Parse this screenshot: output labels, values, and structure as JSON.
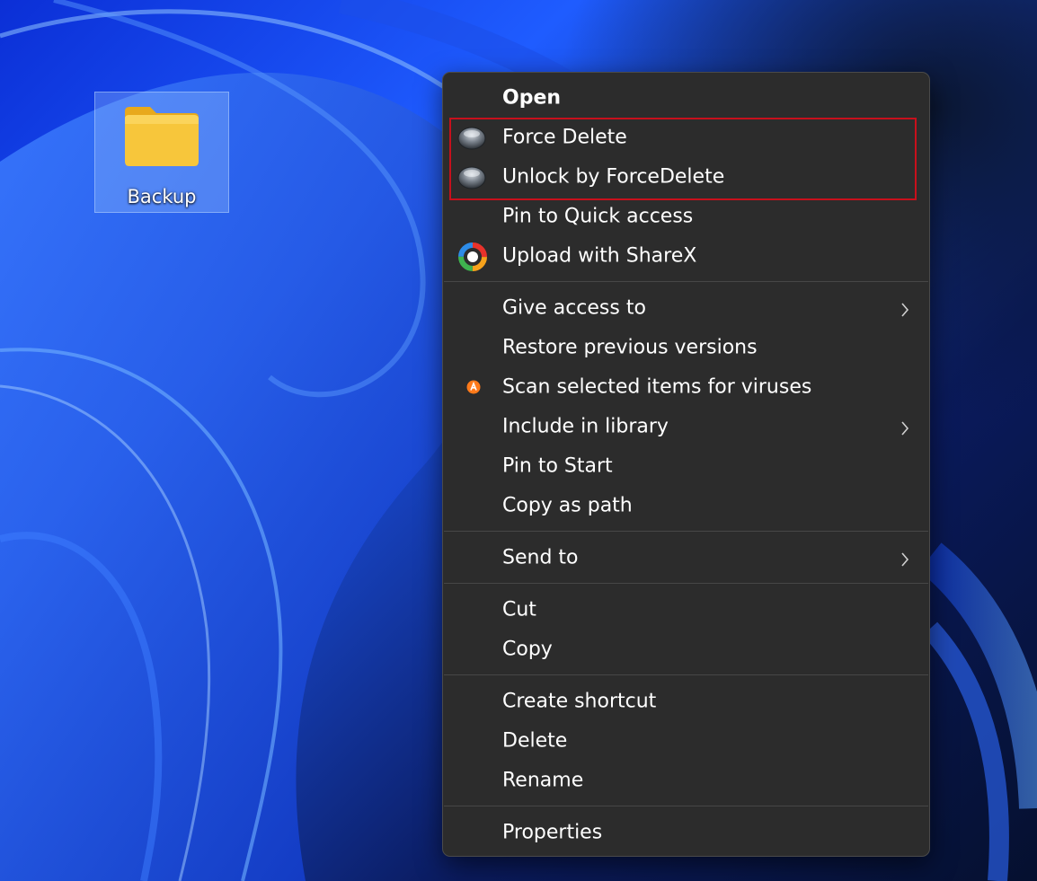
{
  "desktop": {
    "icon": {
      "label": "Backup",
      "icon_name": "folder-icon"
    }
  },
  "context_menu": {
    "items": [
      {
        "label": "Open",
        "bold": true
      },
      {
        "label": "Force Delete",
        "icon_name": "force-delete-icon"
      },
      {
        "label": "Unlock by ForceDelete",
        "icon_name": "unlock-icon"
      },
      {
        "label": "Pin to Quick access"
      },
      {
        "label": "Upload with ShareX",
        "icon_name": "sharex-icon"
      },
      {
        "label": "Give access to",
        "submenu": true
      },
      {
        "label": "Restore previous versions"
      },
      {
        "label": "Scan selected items for viruses",
        "icon_name": "avast-icon"
      },
      {
        "label": "Include in library",
        "submenu": true
      },
      {
        "label": "Pin to Start"
      },
      {
        "label": "Copy as path"
      },
      {
        "label": "Send to",
        "submenu": true
      },
      {
        "label": "Cut"
      },
      {
        "label": "Copy"
      },
      {
        "label": "Create shortcut"
      },
      {
        "label": "Delete"
      },
      {
        "label": "Rename"
      },
      {
        "label": "Properties"
      }
    ],
    "highlight_color": "#c8101c"
  }
}
